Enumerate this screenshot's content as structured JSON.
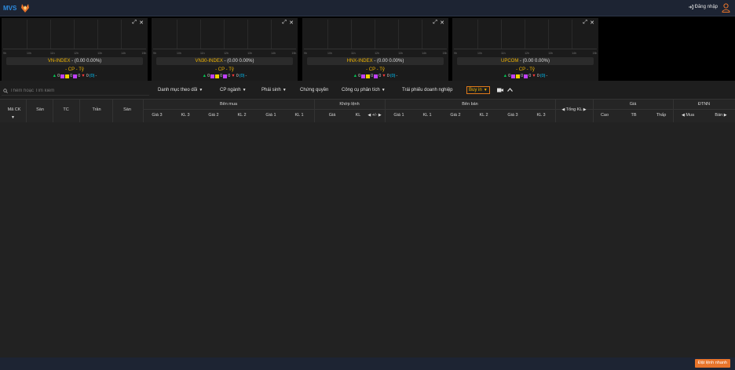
{
  "header": {
    "logo_text": "MVS",
    "login_label": "Đăng nhập"
  },
  "index_panels": [
    {
      "name": "VN-INDEX",
      "change": " - (0.00 0.00%)",
      "cp": "- CP - Tỷ",
      "up": "0",
      "ref": "0",
      "ceil": "0",
      "down": "0",
      "floor": "(0)",
      "tail": "-"
    },
    {
      "name": "VN30-INDEX",
      "change": " - (0.00 0.00%)",
      "cp": "- CP - Tỷ",
      "up": "0",
      "ref": "0",
      "ceil": "0",
      "down": "0",
      "floor": "(0)",
      "tail": "-"
    },
    {
      "name": "HNX-INDEX",
      "change": " - (0.00 0.00%)",
      "cp": "- CP - Tỷ",
      "up": "0",
      "ref": "0",
      "ceil": "0",
      "down": "0",
      "floor": "(0)",
      "tail": "-"
    },
    {
      "name": "UPCOM",
      "change": " - (0.00 0.00%)",
      "cp": "- CP - Tỷ",
      "up": "0",
      "ref": "0",
      "ceil": "0",
      "down": "0",
      "floor": "(0)",
      "tail": "-"
    }
  ],
  "chart_ticks": [
    "9h",
    "10h",
    "11h",
    "12h",
    "13h",
    "14h",
    "15h"
  ],
  "toolbar": {
    "search_placeholder": "Thêm hoặc Tìm kiếm",
    "menus": [
      "Danh mục theo dõi",
      "CP ngành",
      "Phái sinh",
      "Chứng quyền",
      "Công cụ phân tích",
      "Trái phiếu doanh nghiệp"
    ],
    "active_menu": "Buy in"
  },
  "table": {
    "groups": {
      "ben_mua": "Bên mua",
      "khop_lenh": "Khớp lệnh",
      "ben_ban": "Bên bán",
      "tong_kl": "Tổng KL",
      "gia": "Giá",
      "dtnn": "ĐTNN"
    },
    "cols": {
      "ma_ck": "Mã CK",
      "san": "Sàn",
      "tc": "TC",
      "tran": "Trần",
      "san2": "Sàn",
      "mua_gia3": "Giá 3",
      "mua_kl3": "KL 3",
      "mua_gia2": "Giá 2",
      "mua_kl2": "KL 2",
      "mua_gia1": "Giá 1",
      "mua_kl1": "KL 1",
      "kl_gia": "Giá",
      "kl_kl": "KL",
      "kl_pm": "+/-",
      "ban_gia1": "Giá 1",
      "ban_kl1": "KL 1",
      "ban_gia2": "Giá 2",
      "ban_kl2": "KL 2",
      "ban_gia3": "Giá 3",
      "ban_kl3": "KL 3",
      "gia_cao": "Cao",
      "gia_tb": "TB",
      "gia_thap": "Thấp",
      "nn_mua": "Mua",
      "nn_ban": "Bán"
    }
  },
  "footer": {
    "quick_order": "Đặt lệnh nhanh"
  },
  "colors": {
    "accent": "#e8742a",
    "index_name": "#f0b400",
    "up": "#00c853",
    "ceil": "#c040ff",
    "ref": "#f0d000",
    "down": "#ff3b3b",
    "floor": "#00c8ff"
  }
}
